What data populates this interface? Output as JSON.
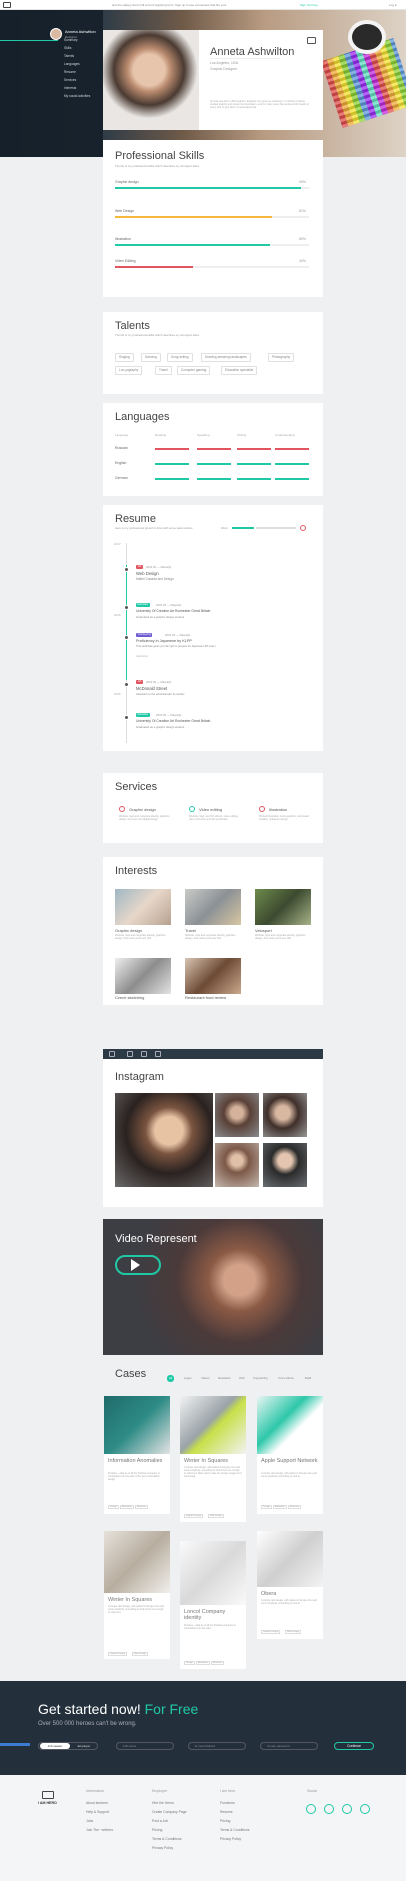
{
  "topbar": {
    "message": "Get the Happy Hero! Fill a form! Applying form. Sign up to use a business that fits you!",
    "signup": "Sign Up Free",
    "login": "Log in"
  },
  "sidebar": {
    "name": "Anneta Ashwilton",
    "role": "Designer",
    "items": [
      "Summary",
      "Skills",
      "Talents",
      "Languages",
      "Resume",
      "Services",
      "Interests",
      "My social activities"
    ]
  },
  "profile": {
    "name": "Anneta Ashwilton",
    "location": "Los Angeles, USA",
    "role": "Graphic Designer",
    "bio": "Anneta was born in Birmingham, England, she grew up creatively, in a family of artists, studied graphic and visual communication, and for many years has worked with brands of every size to give them a memorable look."
  },
  "skills": {
    "title": "Professional Skills",
    "subtitle": "The list of my professional skills which describes my strongest sides",
    "items": [
      {
        "label": "Graphic design",
        "pct": "96%",
        "value": 0.96,
        "color": "#20c9a6"
      },
      {
        "label": "Web Design",
        "pct": "81%",
        "value": 0.81,
        "color": "#f5b83a"
      },
      {
        "label": "Illustration",
        "pct": "80%",
        "value": 0.8,
        "color": "#20c9a6"
      },
      {
        "label": "Video Editing",
        "pct": "40%",
        "value": 0.4,
        "color": "#e2555f"
      }
    ]
  },
  "talents": {
    "title": "Talents",
    "subtitle": "The list of my professional skills which describes my strongest sides",
    "tags": [
      "Singing",
      "Dancing",
      "Song writing",
      "Drawing amazing landscapes",
      "Photography",
      "Lux-yography",
      "Travel",
      "Computer gaming",
      "Education specialist"
    ]
  },
  "languages": {
    "title": "Languages",
    "headers": [
      "Language",
      "Reading",
      "Speaking",
      "Writing",
      "Understanding"
    ],
    "rows": [
      {
        "name": "Russian",
        "color": "#e2555f"
      },
      {
        "name": "English",
        "color": "#20c9a6"
      },
      {
        "name": "German",
        "color": "#20c9a6"
      }
    ]
  },
  "resume": {
    "title": "Resume",
    "subtitle": "Here is my professional growth in brief with some latest entries",
    "legend": "Work",
    "years": [
      "2017",
      "2016",
      "2015"
    ],
    "entries": [
      {
        "badge": "Job",
        "badge_color": "#e2555f",
        "date": "2016.05 — Maqui(k)",
        "title": "Web Design",
        "place": "Mattel Canada and Design",
        "note": ""
      },
      {
        "badge": "Education",
        "badge_color": "#20c9a6",
        "date": "2015.05 — Maqui(k)",
        "title": "University Of Creative Art Rochester Great Britain",
        "place": "Graduated as a graphic design student",
        "note": ""
      },
      {
        "badge": "Volunteering",
        "badge_color": "#6d5bd0",
        "date": "2015.03 — Maqui(k)",
        "title": "Proficiency in Japanese by KLPP",
        "place": "This certificate gives you the right to prepare for Japanese LPP exam.",
        "note": "Upcoming"
      },
      {
        "badge": "Job",
        "badge_color": "#e2555f",
        "date": "2016.05 — Maqui(k)",
        "title": "McDonald Street",
        "place": "Assistant to the administrator & cashier",
        "note": ""
      },
      {
        "badge": "Education",
        "badge_color": "#20c9a6",
        "date": "2015.05 — Maqui(k)",
        "title": "University Of Creative Art Rochester Great Britain",
        "place": "Graduated as a graphic design student",
        "note": ""
      }
    ]
  },
  "services": {
    "title": "Services",
    "items": [
      {
        "title": "Graphic design",
        "desc": "Website, logo and corporate identity, graphics design, icon sets and digital design"
      },
      {
        "title": "Video editing",
        "desc": "Website, logo, and film effects, video editing, color correction and film production"
      },
      {
        "title": "Illustration",
        "desc": "Printed illustration, book graphics, storyboard creation, character design"
      }
    ]
  },
  "interests": {
    "title": "Interests",
    "items": [
      {
        "title": "Graphic design",
        "desc": "Website, logo and corporate identity, graphics design. Fine work you'll ever find"
      },
      {
        "title": "Travel",
        "desc": "Website, logo and corporate identity, graphics design. Fine work you'll ever find"
      },
      {
        "title": "Velosport",
        "desc": "Website, logo and corporate identity, graphics design. Fine work you'll ever find"
      },
      {
        "title": "Czech sketching",
        "desc": "Website, logo and corporate identity, graphics design. Fine work you'll ever find"
      },
      {
        "title": "Restaurant food review",
        "desc": "Website, logo and corporate identity, graphics design. Fine work you'll ever find"
      }
    ]
  },
  "instagram": {
    "title": "Instagram"
  },
  "video": {
    "title": "Video Represent"
  },
  "cases": {
    "title": "Cases",
    "filters": [
      "All",
      "Logos",
      "Videos",
      "Illustration",
      "Web",
      "Copywriting",
      "Tours effects",
      "Build"
    ],
    "items": [
      {
        "title": "Information Anomalies",
        "desc": "Perhaps – data as to all the finished examples of minimalism from the start of the best minimalistic design",
        "tags": [
          "Design",
          "Animation",
          "Brochure"
        ]
      },
      {
        "title": "Winter In Squares",
        "desc": "A simple card design, with patterns that give the card some simplicity, something to look at but not enough to stand out. Dark colors make the design elegant and interesting.",
        "tags": [
          "Graphic Design",
          "Web Design"
        ]
      },
      {
        "title": "Apple Support Network",
        "desc": "A simple card design, with patterns that give the card some simplicity, something to look at.",
        "tags": [
          "Design",
          "Animation",
          "Brochure"
        ]
      },
      {
        "title": "Winter In Squares",
        "desc": "A simple card design, with patterns that give the card some simplicity, something to look at but not enough to stand out.",
        "tags": [
          "Graphic Design",
          "Web Design"
        ]
      },
      {
        "title": "Loncol Company identity",
        "desc": "Perhaps – data as to all the finished examples of minimalism from the start.",
        "tags": [
          "Design",
          "Animation",
          "Brochure"
        ]
      },
      {
        "title": "Obera",
        "desc": "A simple card design, with patterns that give the card some simplicity, something to look at.",
        "tags": [
          "Graphic Design",
          "Web Design"
        ]
      }
    ]
  },
  "cta": {
    "headline": "Get started now!",
    "headline_accent": "For Free",
    "sub": "Over 500 000 heroes can't be wrong.",
    "toggle": [
      "Job seeker",
      "Employer"
    ],
    "placeholders": [
      "Full name",
      "E-mail Address",
      "Create password"
    ],
    "button": "Continue"
  },
  "footer": {
    "logo": "I AM HERO",
    "columns": [
      {
        "title": "Information",
        "links": [
          "About iamhero",
          "Help & Support",
          "Jobs",
          "Join The ~wrthero"
        ]
      },
      {
        "title": "Employer",
        "links": [
          "Hire the Heros",
          "Create Company Page",
          "Post a Job",
          "Pricing",
          "Terms & Conditions",
          "Privacy Policy"
        ]
      },
      {
        "title": "I am hero",
        "links": [
          "Functions",
          "Resume",
          "Pricing",
          "Terms & Conditions",
          "Privacy Policy"
        ]
      },
      {
        "title": "Social",
        "links": []
      }
    ]
  }
}
